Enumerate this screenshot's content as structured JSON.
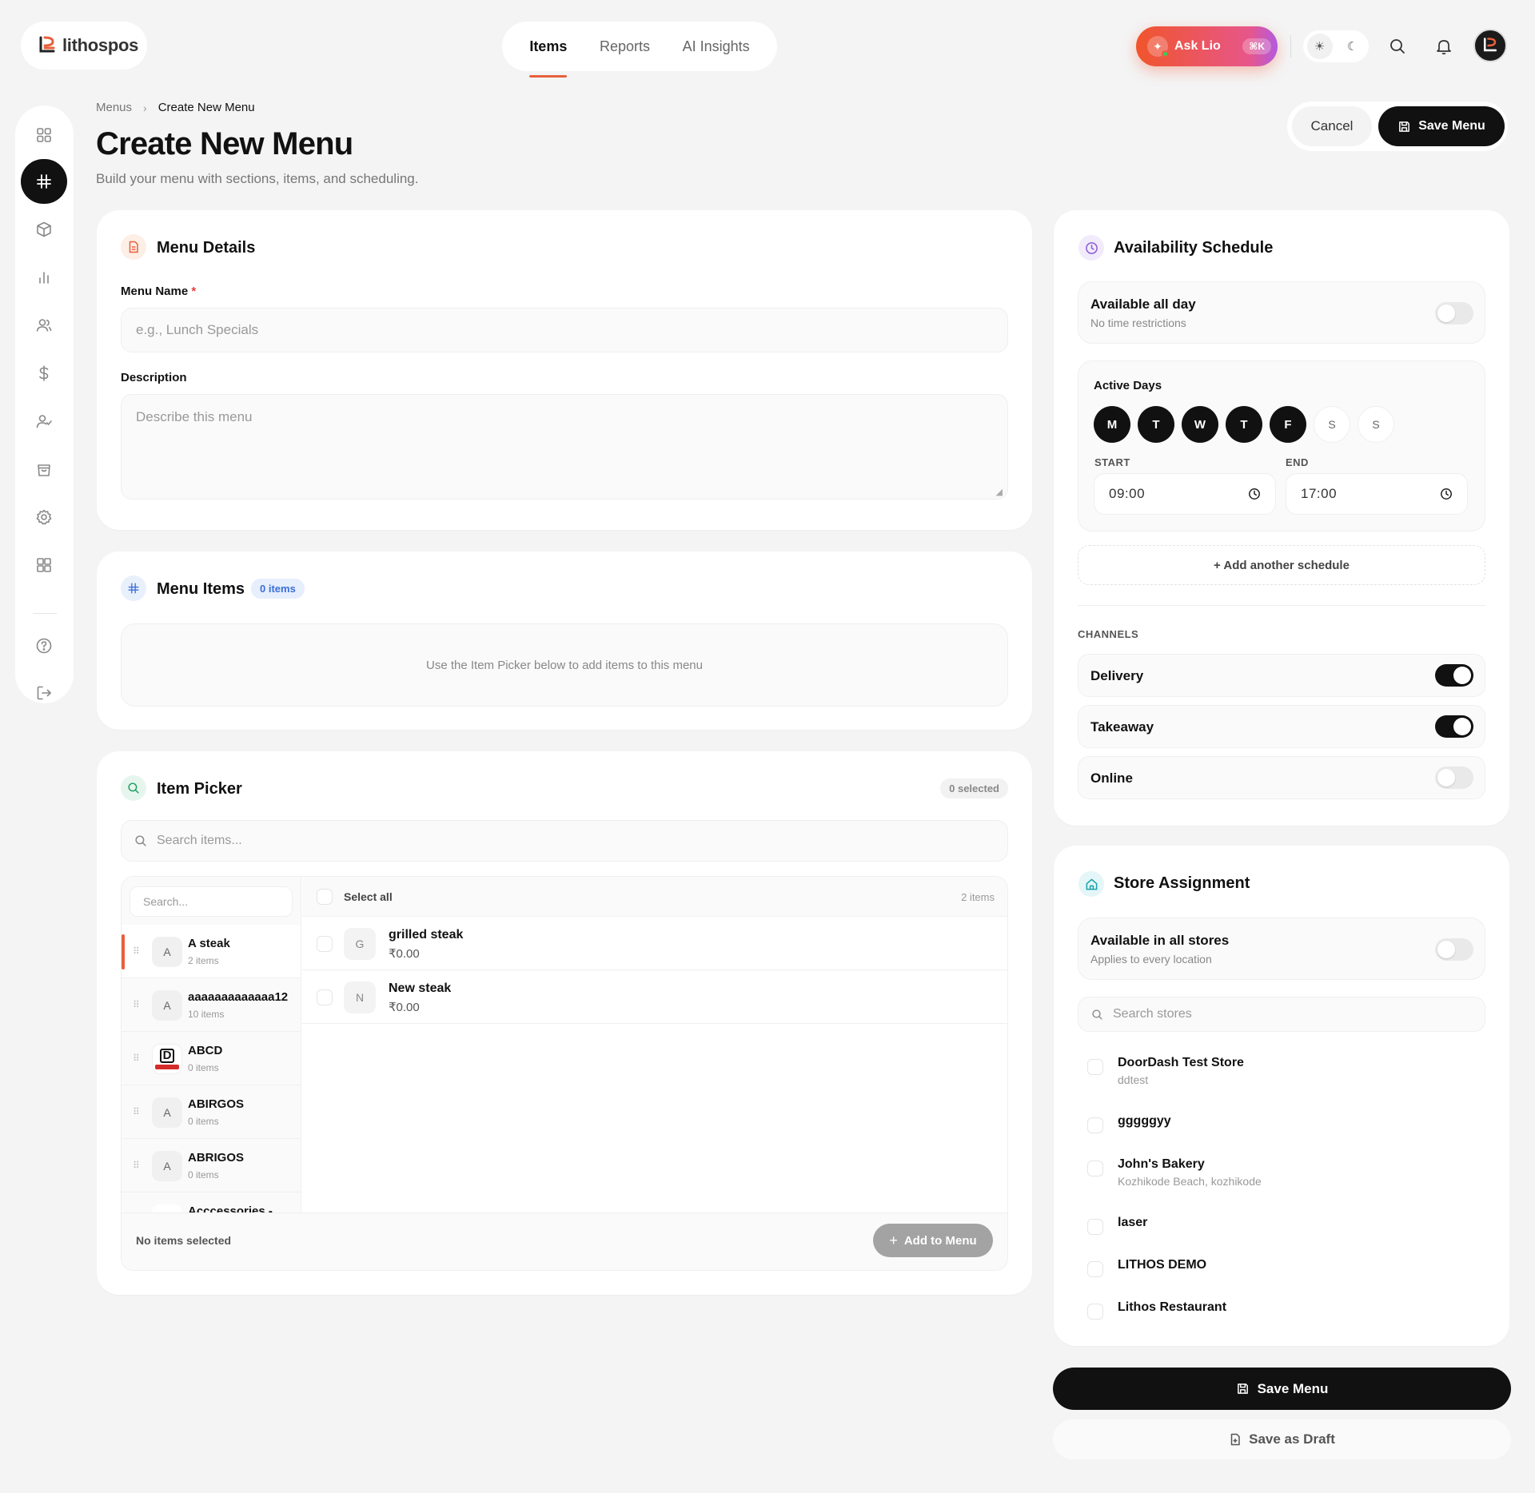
{
  "app": {
    "logo_text": "lithospos"
  },
  "nav": {
    "tabs": [
      {
        "label": "Items"
      },
      {
        "label": "Reports"
      },
      {
        "label": "AI Insights"
      }
    ]
  },
  "topbar": {
    "ask_label": "Ask Lio",
    "ask_shortcut": "⌘K"
  },
  "page": {
    "breadcrumb": {
      "root": "Menus",
      "current": "Create New Menu"
    },
    "title": "Create New Menu",
    "subtitle": "Build your menu with sections, items, and scheduling.",
    "cancel_label": "Cancel",
    "save_label": "Save Menu"
  },
  "menu_details": {
    "title": "Menu Details",
    "name_label": "Menu Name",
    "required_mark": "*",
    "name_placeholder": "e.g., Lunch Specials",
    "desc_label": "Description",
    "desc_placeholder": "Describe this menu"
  },
  "menu_items": {
    "title": "Menu Items",
    "badge": "0 items",
    "empty_text": "Use the Item Picker below to add items to this menu"
  },
  "item_picker": {
    "title": "Item Picker",
    "selected_badge": "0 selected",
    "search_placeholder": "Search items...",
    "category_search_placeholder": "Search...",
    "select_all_label": "Select all",
    "items_count": "2 items",
    "categories": [
      {
        "initial": "A",
        "name": "A steak",
        "count": "2 items",
        "active": true
      },
      {
        "initial": "A",
        "name": "aaaaaaaaaaaaa12",
        "count": "10 items"
      },
      {
        "initial": "D",
        "name": "ABCD",
        "count": "0 items",
        "logo": true
      },
      {
        "initial": "A",
        "name": "ABIRGOS",
        "count": "0 items"
      },
      {
        "initial": "A",
        "name": "ABRIGOS",
        "count": "0 items"
      },
      {
        "initial": "",
        "name": "Acccessories -",
        "count": ""
      }
    ],
    "items": [
      {
        "initial": "G",
        "name": "grilled steak",
        "price": "₹0.00"
      },
      {
        "initial": "N",
        "name": "New steak",
        "price": "₹0.00"
      }
    ],
    "footer_status": "No items selected",
    "add_label": "Add to Menu"
  },
  "availability": {
    "title": "Availability Schedule",
    "all_day_title": "Available all day",
    "all_day_sub": "No time restrictions",
    "all_day_on": false,
    "active_days_label": "Active Days",
    "days": [
      {
        "letter": "M",
        "on": true
      },
      {
        "letter": "T",
        "on": true
      },
      {
        "letter": "W",
        "on": true
      },
      {
        "letter": "T",
        "on": true
      },
      {
        "letter": "F",
        "on": true
      },
      {
        "letter": "S",
        "on": false
      },
      {
        "letter": "S",
        "on": false
      }
    ],
    "start_label": "START",
    "start_value": "09:00",
    "end_label": "END",
    "end_value": "17:00",
    "add_schedule_label": "+ Add another schedule",
    "channels_label": "CHANNELS",
    "channels": [
      {
        "name": "Delivery",
        "on": true
      },
      {
        "name": "Takeaway",
        "on": true
      },
      {
        "name": "Online",
        "on": false
      }
    ]
  },
  "stores": {
    "title": "Store Assignment",
    "all_title": "Available in all stores",
    "all_sub": "Applies to every location",
    "search_placeholder": "Search stores",
    "list": [
      {
        "name": "DoorDash Test Store",
        "sub": "ddtest"
      },
      {
        "name": "gggggyy",
        "sub": ""
      },
      {
        "name": "John's Bakery",
        "sub": "Kozhikode Beach, kozhikode"
      },
      {
        "name": "laser",
        "sub": ""
      },
      {
        "name": "LITHOS DEMO",
        "sub": ""
      },
      {
        "name": "Lithos Restaurant",
        "sub": ""
      }
    ]
  },
  "footer_actions": {
    "save_label": "Save Menu",
    "draft_label": "Save as Draft"
  },
  "colors": {
    "accent": "#e8603c",
    "primary": "#111111",
    "badge_blue": "#3a6fd8"
  }
}
